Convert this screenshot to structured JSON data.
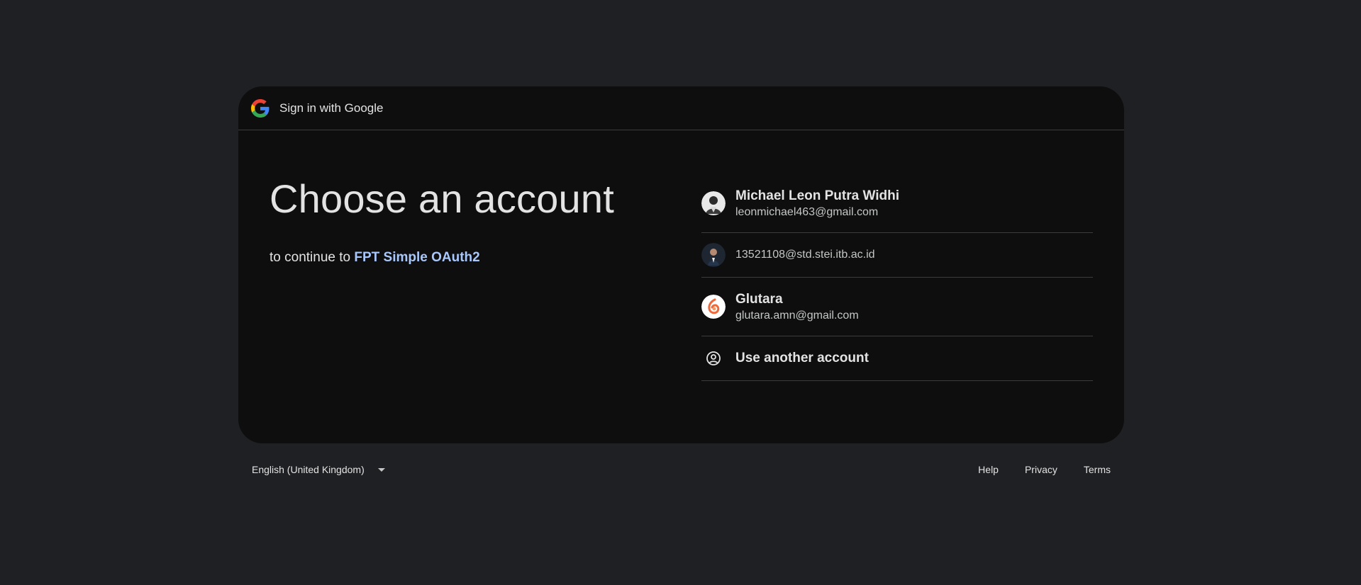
{
  "header": {
    "title": "Sign in with Google",
    "logo_icon": "google-g-logo"
  },
  "main": {
    "title": "Choose an account",
    "subtitle_prefix": "to continue to",
    "app_name": "FPT Simple OAuth2"
  },
  "accounts": [
    {
      "name": "Michael Leon Putra Widhi",
      "email": "leonmichael463@gmail.com",
      "avatar": "profile-photo"
    },
    {
      "name": "",
      "email": "13521108@std.stei.itb.ac.id",
      "avatar": "profile-photo"
    },
    {
      "name": "Glutara",
      "email": "glutara.amn@gmail.com",
      "avatar": "glutara-logo"
    }
  ],
  "use_another": {
    "label": "Use another account",
    "icon": "account-circle-icon"
  },
  "footer": {
    "language": "English (United Kingdom)",
    "help": "Help",
    "privacy": "Privacy",
    "terms": "Terms"
  },
  "colors": {
    "page_bg": "#1f2023",
    "card_bg": "#0e0e0f",
    "link": "#a8c7fa",
    "divider": "#3c3c3c"
  }
}
